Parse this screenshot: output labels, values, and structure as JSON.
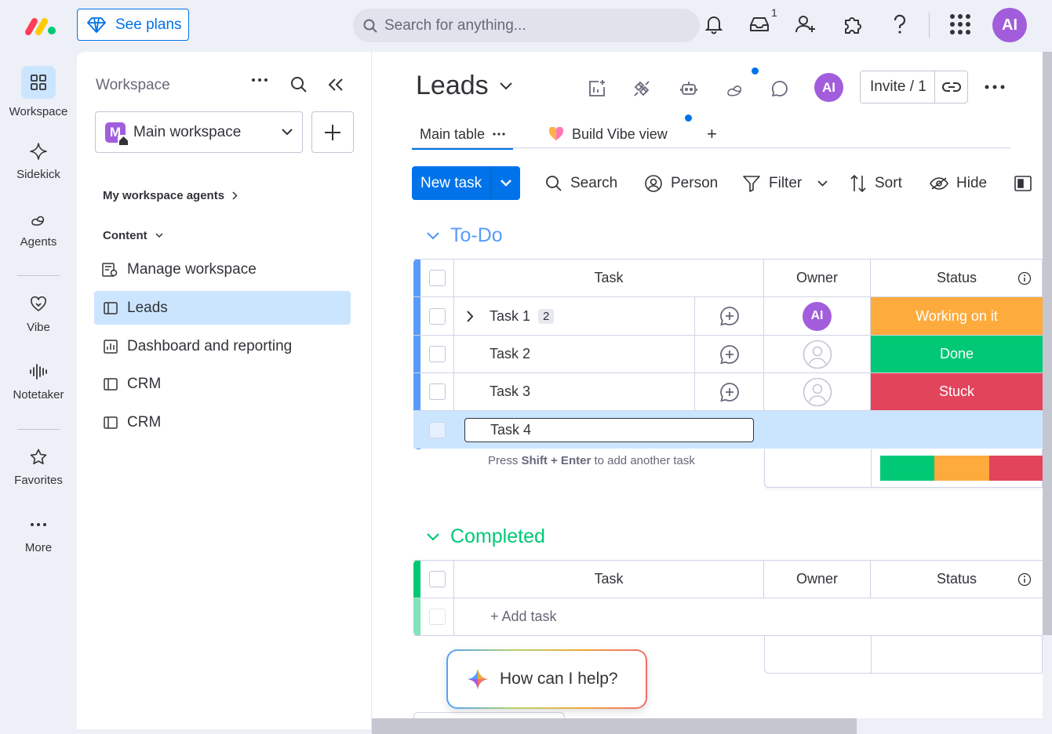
{
  "topbar": {
    "see_plans": "See plans",
    "search_placeholder": "Search for anything...",
    "inbox_badge": "1",
    "avatar": "AI"
  },
  "rail": {
    "items": [
      {
        "label": "Workspace",
        "icon": "grid-icon"
      },
      {
        "label": "Sidekick",
        "icon": "sparkle-icon"
      },
      {
        "label": "Agents",
        "icon": "agents-icon"
      },
      {
        "label": "Vibe",
        "icon": "heart-icon"
      },
      {
        "label": "Notetaker",
        "icon": "waveform-icon"
      },
      {
        "label": "Favorites",
        "icon": "star-icon"
      },
      {
        "label": "More",
        "icon": "more-icon"
      }
    ]
  },
  "workspace": {
    "title": "Workspace",
    "selected": "Main workspace",
    "selected_initial": "M",
    "agents_label": "My workspace agents",
    "content_label": "Content",
    "items": [
      {
        "label": "Manage workspace"
      },
      {
        "label": "Leads"
      },
      {
        "label": "Dashboard and reporting"
      },
      {
        "label": "CRM"
      },
      {
        "label": "CRM"
      }
    ]
  },
  "board": {
    "title": "Leads",
    "avatar": "AI",
    "invite": "Invite / 1",
    "tabs": {
      "main": "Main table",
      "vibe": "Build Vibe view",
      "add": "+"
    },
    "toolbar": {
      "new_task": "New task",
      "search": "Search",
      "person": "Person",
      "filter": "Filter",
      "sort": "Sort",
      "hide": "Hide"
    },
    "groups": [
      {
        "name": "To-Do",
        "color": "#579bfc",
        "columns": {
          "task": "Task",
          "owner": "Owner",
          "status": "Status"
        },
        "rows": [
          {
            "task": "Task 1",
            "subitems": "2",
            "owner": "AI",
            "status": "Working on it",
            "status_color": "#fdab3d"
          },
          {
            "task": "Task 2",
            "owner": "",
            "status": "Done",
            "status_color": "#00c875"
          },
          {
            "task": "Task 3",
            "owner": "",
            "status": "Stuck",
            "status_color": "#e2445c"
          }
        ],
        "editing_value": "Task 4",
        "hint_prefix": "Press ",
        "hint_keys": "Shift + Enter",
        "hint_suffix": " to add another task",
        "summary_colors": [
          "#00c875",
          "#fdab3d",
          "#e2445c"
        ]
      },
      {
        "name": "Completed",
        "color": "#00c875",
        "columns": {
          "task": "Task",
          "owner": "Owner",
          "status": "Status"
        },
        "add_task": "+ Add task"
      }
    ]
  },
  "assistant": {
    "prompt": "How can I help?"
  }
}
